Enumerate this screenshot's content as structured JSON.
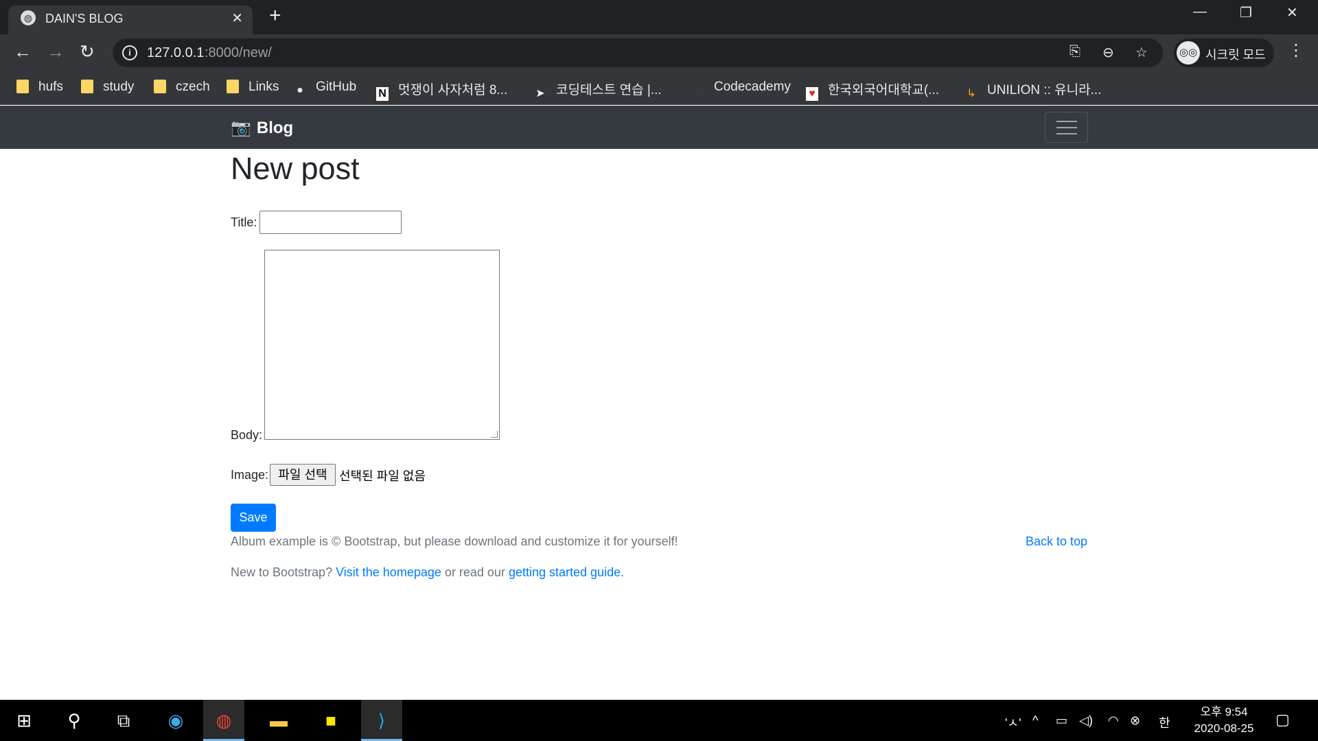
{
  "browser": {
    "tab_title": "DAIN'S BLOG",
    "tab_close": "✕",
    "new_tab": "+",
    "window_controls": {
      "minimize": "—",
      "restore": "❐",
      "close": "✕"
    },
    "url_host": "127.0.0.1",
    "url_path": ":8000/new/",
    "incognito_label": "시크릿 모드",
    "bookmarks": [
      {
        "label": "hufs",
        "icon": "folder-icon"
      },
      {
        "label": "study",
        "icon": "folder-icon"
      },
      {
        "label": "czech",
        "icon": "folder-icon"
      },
      {
        "label": "Links",
        "icon": "folder-icon"
      },
      {
        "label": "GitHub",
        "icon": "github-icon"
      },
      {
        "label": "멋쟁이 사자처럼 8...",
        "icon": "notion-icon"
      },
      {
        "label": "코딩테스트 연습 |...",
        "icon": "programmers-icon"
      },
      {
        "label": "Codecademy",
        "icon": "codecademy-icon"
      },
      {
        "label": "한국외국어대학교(...",
        "icon": "hufs-heart-icon"
      },
      {
        "label": "UNILION :: 유니라...",
        "icon": "unilion-icon"
      }
    ]
  },
  "site": {
    "brand": "Blog",
    "page_title": "New post",
    "form": {
      "title_label": "Title:",
      "title_value": "",
      "body_label": "Body:",
      "body_value": "",
      "image_label": "Image:",
      "file_button": "파일 선택",
      "file_status": "선택된 파일 없음",
      "save": "Save"
    },
    "footer": {
      "line1": "Album example is © Bootstrap, but please download and customize it for yourself!",
      "back_to_top": "Back to top",
      "line2_prefix": "New to Bootstrap?",
      "homepage_link": "Visit the homepage",
      "line2_middle": "or read our",
      "guide_link": "getting started guide",
      "line2_suffix": "."
    }
  },
  "taskbar": {
    "ime_indicator": "'ㅅ'",
    "lang": "한",
    "time": "오후 9:54",
    "date": "2020-08-25"
  },
  "colors": {
    "navbar": "#343a40",
    "primary": "#007bff",
    "chrome_dark": "#202124",
    "chrome_toolbar": "#35363a"
  }
}
